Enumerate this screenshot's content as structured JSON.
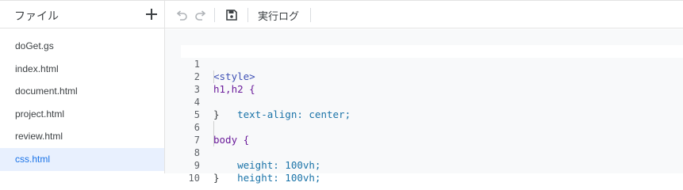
{
  "sidebar": {
    "title": "ファイル",
    "add_icon": "plus-icon",
    "files": [
      {
        "name": "doGet.gs",
        "selected": false
      },
      {
        "name": "index.html",
        "selected": false
      },
      {
        "name": "document.html",
        "selected": false
      },
      {
        "name": "project.html",
        "selected": false
      },
      {
        "name": "review.html",
        "selected": false
      },
      {
        "name": "css.html",
        "selected": true
      }
    ]
  },
  "toolbar": {
    "undo_icon": "undo-icon",
    "redo_icon": "redo-icon",
    "save_icon": "save-icon",
    "run_log_label": "実行ログ"
  },
  "editor": {
    "lines": [
      {
        "number": "1",
        "text": "<style>"
      },
      {
        "number": "2",
        "text": "h1,h2 {"
      },
      {
        "number": "3",
        "text": "    text-align: center;"
      },
      {
        "number": "4",
        "text": "}"
      },
      {
        "number": "5",
        "text": ""
      },
      {
        "number": "6",
        "text": "body {"
      },
      {
        "number": "7",
        "text": "    weight: 100vh;"
      },
      {
        "number": "8",
        "text": "    height: 100vh;"
      },
      {
        "number": "9",
        "text": "}"
      },
      {
        "number": "10",
        "text": ""
      }
    ]
  },
  "colors": {
    "selected_bg": "#e8f0fe",
    "selected_text": "#1a73e8",
    "editor_bg": "#f8f9fa",
    "tag_color": "#3f51b5",
    "selector_color": "#6a1b9a",
    "property_color": "#1a73a8",
    "keyword_value_color": "#b3261e",
    "number_value_color": "#1f7a4f"
  }
}
